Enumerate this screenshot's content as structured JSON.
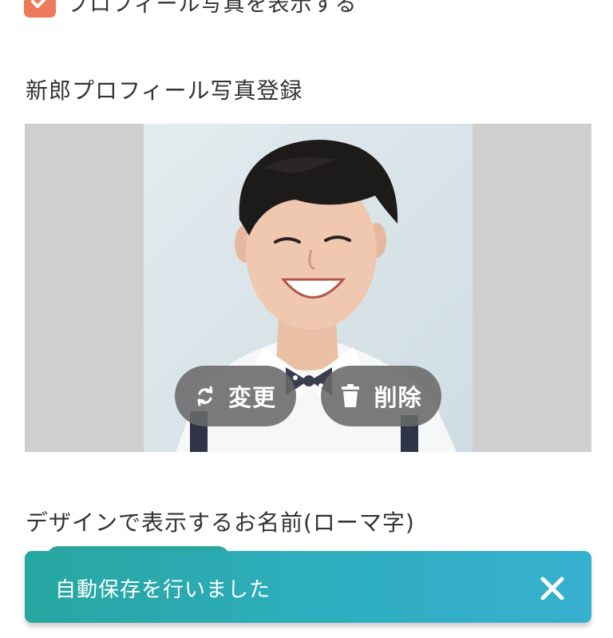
{
  "profile_photo_toggle": {
    "label": "プロフィール写真を表示する",
    "checked": true,
    "check_color": "#ef7a5a",
    "icon": "checkmark-icon"
  },
  "groom_photo": {
    "title": "新郎プロフィール写真登録",
    "change_label": "変更",
    "change_icon": "refresh-icon",
    "delete_label": "削除",
    "delete_icon": "trash-icon"
  },
  "display_name": {
    "title": "デザインで表示するお名前(ローマ字)"
  },
  "toast": {
    "message": "自動保存を行いました",
    "close_icon": "close-icon",
    "color": "#2aaab0"
  }
}
